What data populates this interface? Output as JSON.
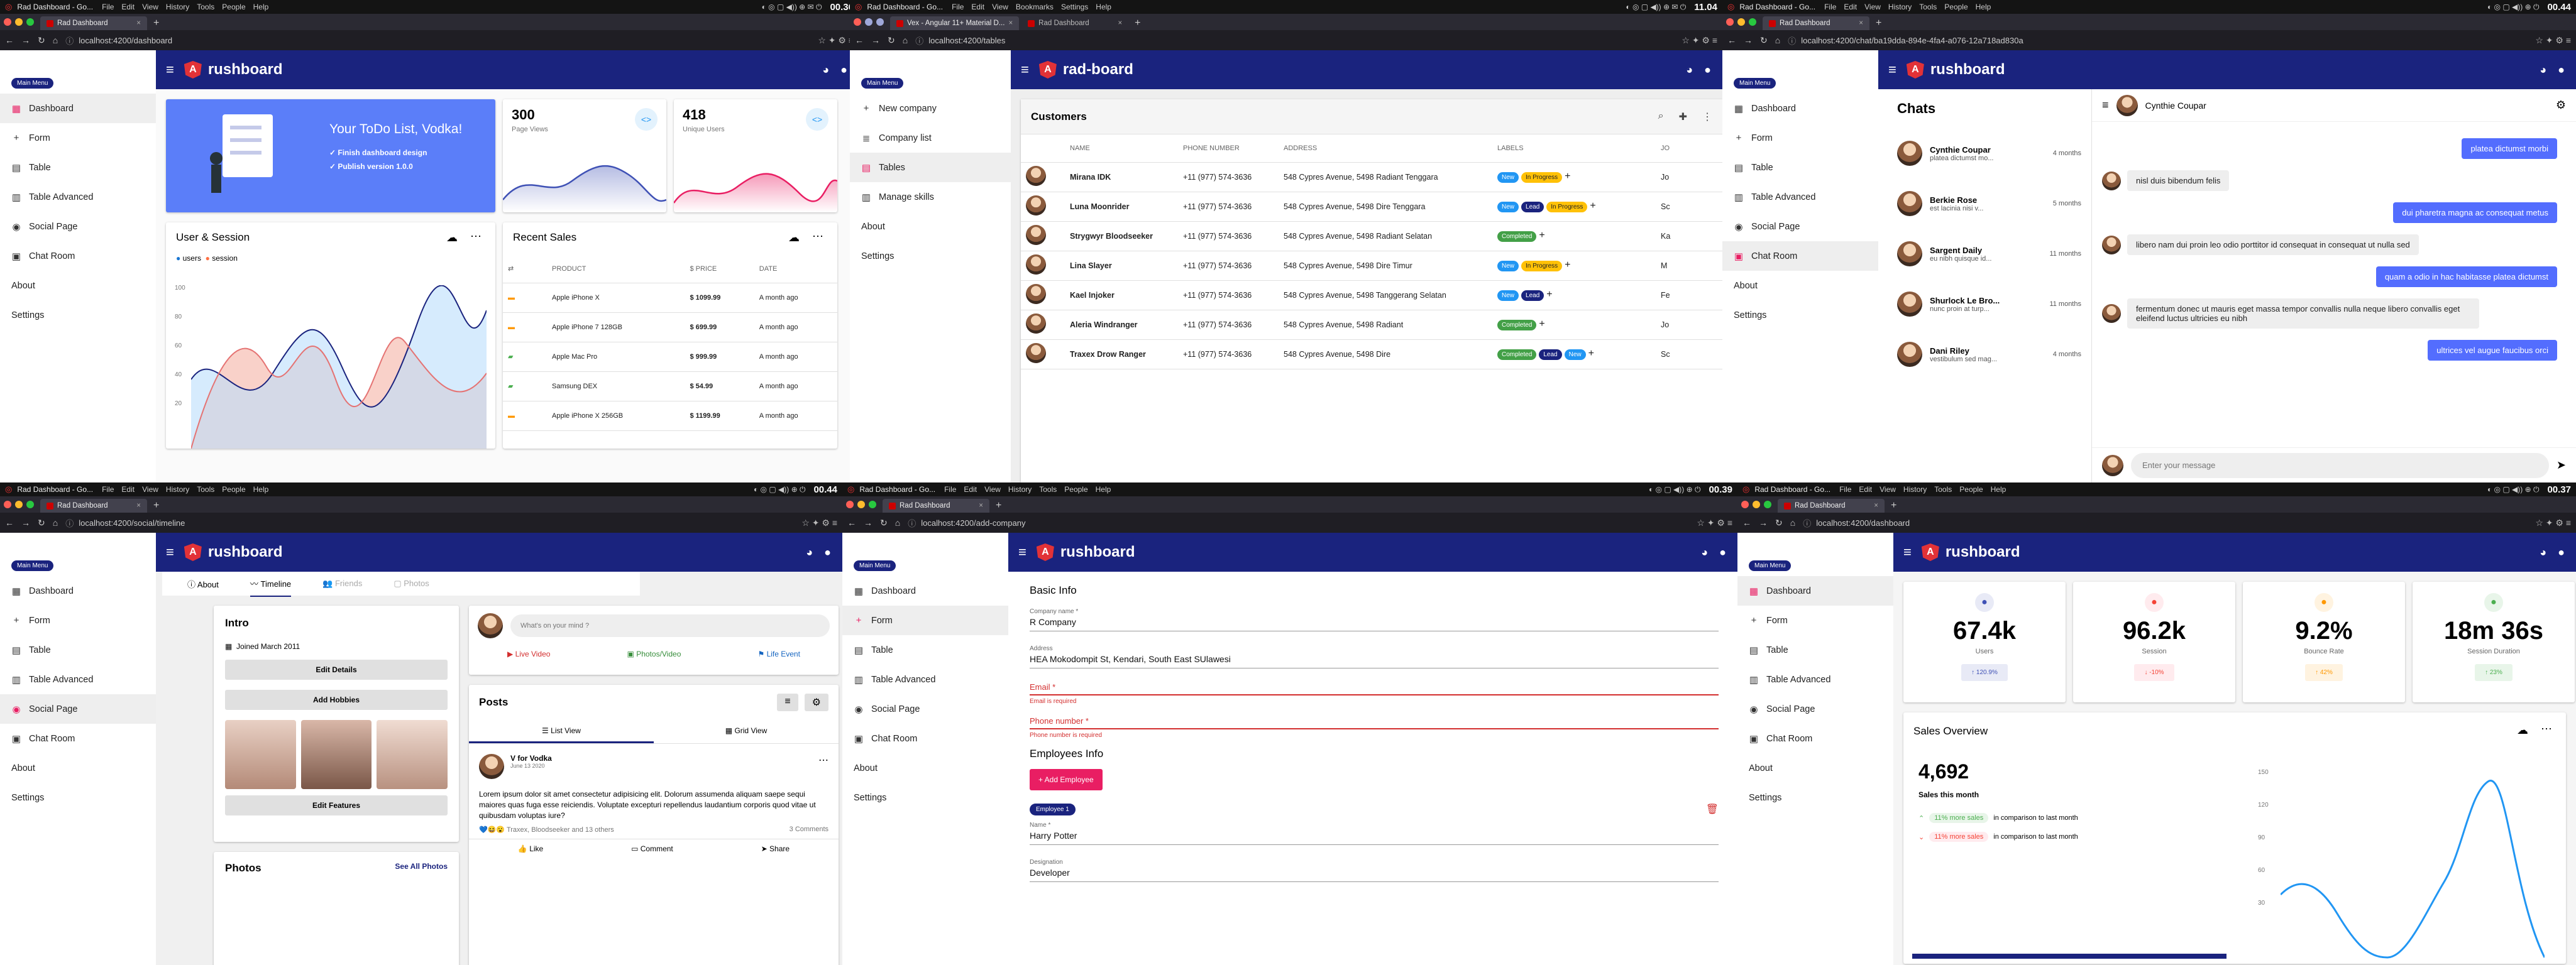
{
  "panels": [
    {
      "clock": "00.36",
      "apptitle": "Rad Dashboard - Go...",
      "menus": [
        "File",
        "Edit",
        "View",
        "History",
        "Tools",
        "People",
        "Help"
      ],
      "tabs": [
        "Rad Dashboard"
      ],
      "url": "localhost:4200/dashboard"
    },
    {
      "clock": "11.04",
      "apptitle": "Rad Dashboard - Go...",
      "menus": [
        "File",
        "Edit",
        "View",
        "Bookmarks",
        "Settings",
        "Help"
      ],
      "tabs": [
        "Vex - Angular 11+ Material D...",
        "Rad Dashboard"
      ],
      "url": "localhost:4200/tables"
    },
    {
      "clock": "00.44",
      "apptitle": "Rad Dashboard - Go...",
      "menus": [
        "File",
        "Edit",
        "View",
        "History",
        "Tools",
        "People",
        "Help"
      ],
      "tabs": [
        "Rad Dashboard"
      ],
      "url": "localhost:4200/chat/ba19dda-894e-4fa4-a076-12a718ad830a"
    },
    {
      "clock": "00.44",
      "apptitle": "Rad Dashboard - Go...",
      "menus": [
        "File",
        "Edit",
        "View",
        "History",
        "Tools",
        "People",
        "Help"
      ],
      "tabs": [
        "Rad Dashboard"
      ],
      "url": "localhost:4200/social/timeline"
    },
    {
      "clock": "00.39",
      "apptitle": "Rad Dashboard - Go...",
      "menus": [
        "File",
        "Edit",
        "View",
        "History",
        "Tools",
        "People",
        "Help"
      ],
      "tabs": [
        "Rad Dashboard"
      ],
      "url": "localhost:4200/add-company"
    },
    {
      "clock": "00.37",
      "apptitle": "Rad Dashboard - Go...",
      "menus": [
        "File",
        "Edit",
        "View",
        "History",
        "Tools",
        "People",
        "Help"
      ],
      "tabs": [
        "Rad Dashboard"
      ],
      "url": "localhost:4200/dashboard"
    }
  ],
  "brand": "rushboard",
  "brand_alt": "rad-board",
  "main_menu": "Main Menu",
  "sidebar_items": [
    "Dashboard",
    "Form",
    "Table",
    "Table Advanced",
    "Social Page",
    "Chat Room",
    "About",
    "Settings"
  ],
  "sidebar_tables": [
    "New company",
    "Company list",
    "Tables",
    "Manage skills",
    "About",
    "Settings"
  ],
  "dash1": {
    "todo_title": "Your ToDo List, Vodka!",
    "todo_items": [
      "Finish dashboard design",
      "Publish version 1.0.0"
    ],
    "page_views": "300",
    "page_views_label": "Page Views",
    "unique_users": "418",
    "unique_users_label": "Unique Users",
    "user_session_title": "User & Session",
    "legend": [
      "users",
      "session"
    ],
    "y_ticks": [
      "100",
      "80",
      "60",
      "40",
      "20"
    ],
    "recent_sales_title": "Recent Sales",
    "sales_headers": [
      "PRODUCT",
      "$ PRICE",
      "DATE"
    ],
    "sales_rows": [
      [
        "Apple iPhone X",
        "$ 1099.99",
        "A month ago"
      ],
      [
        "Apple iPhone 7 128GB",
        "$ 699.99",
        "A month ago"
      ],
      [
        "Apple Mac Pro",
        "$ 999.99",
        "A month ago"
      ],
      [
        "Samsung DEX",
        "$ 54.99",
        "A month ago"
      ],
      [
        "Apple iPhone X 256GB",
        "$ 1199.99",
        "A month ago"
      ]
    ]
  },
  "tables": {
    "title": "Customers",
    "headers": [
      "NAME",
      "PHONE NUMBER",
      "ADDRESS",
      "LABELS",
      "JO"
    ],
    "rows": [
      {
        "name": "Mirana IDK",
        "phone": "+11 (977) 574-3636",
        "address": "548 Cypres Avenue, 5498 Radiant Tenggara",
        "labels": [
          "New",
          "In Progress"
        ]
      },
      {
        "name": "Luna Moonrider",
        "phone": "+11 (977) 574-3636",
        "address": "548 Cypres Avenue, 5498 Dire Tenggara",
        "labels": [
          "New",
          "Lead",
          "In Progress"
        ]
      },
      {
        "name": "Strygwyr Bloodseeker",
        "phone": "+11 (977) 574-3636",
        "address": "548 Cypres Avenue, 5498 Radiant Selatan",
        "labels": [
          "Completed"
        ]
      },
      {
        "name": "Lina Slayer",
        "phone": "+11 (977) 574-3636",
        "address": "548 Cypres Avenue, 5498 Dire Timur",
        "labels": [
          "New",
          "In Progress"
        ]
      },
      {
        "name": "Kael Injoker",
        "phone": "+11 (977) 574-3636",
        "address": "548 Cypres Avenue, 5498 Tanggerang Selatan",
        "labels": [
          "New",
          "Lead"
        ]
      },
      {
        "name": "Aleria Windranger",
        "phone": "+11 (977) 574-3636",
        "address": "548 Cypres Avenue, 5498 Radiant",
        "labels": [
          "Completed"
        ]
      },
      {
        "name": "Traxex Drow Ranger",
        "phone": "+11 (977) 574-3636",
        "address": "548 Cypres Avenue, 5498 Dire",
        "labels": [
          "Completed",
          "Lead",
          "New"
        ]
      }
    ],
    "jo_col": [
      "Jo",
      "Sc",
      "Ka",
      "M",
      "Fe",
      "Jo",
      "Sc"
    ]
  },
  "chat": {
    "title": "Chats",
    "header_name": "Cynthie Coupar",
    "list": [
      {
        "name": "Cynthie Coupar",
        "preview": "platea dictumst mo...",
        "time": "4 months"
      },
      {
        "name": "Berkie Rose",
        "preview": "est lacinia nisi v...",
        "time": "5 months"
      },
      {
        "name": "Sargent Daily",
        "preview": "eu nibh quisque id...",
        "time": "11 months"
      },
      {
        "name": "Shurlock Le Bro...",
        "preview": "nunc proin at turp...",
        "time": "11 months"
      },
      {
        "name": "Dani Riley",
        "preview": "vestibulum sed mag...",
        "time": "4 months"
      }
    ],
    "messages": [
      {
        "me": true,
        "text": "platea dictumst morbi"
      },
      {
        "me": false,
        "text": "nisl duis bibendum felis"
      },
      {
        "me": true,
        "text": "dui pharetra magna ac consequat metus"
      },
      {
        "me": false,
        "text": "libero nam dui proin leo odio porttitor id consequat in consequat ut nulla sed"
      },
      {
        "me": true,
        "text": "quam a odio in hac habitasse platea dictumst"
      },
      {
        "me": false,
        "text": "fermentum donec ut mauris eget massa tempor convallis nulla neque libero convallis eget eleifend luctus ultricies eu nibh"
      },
      {
        "me": true,
        "text": "ultrices vel augue faucibus orci"
      }
    ],
    "input_placeholder": "Enter your message"
  },
  "social": {
    "tabs": [
      "About",
      "Timeline",
      "Friends",
      "Photos"
    ],
    "intro_title": "Intro",
    "joined": "Joined March 2011",
    "edit_details": "Edit Details",
    "add_hobbies": "Add Hobbies",
    "edit_features": "Edit Features",
    "photos_title": "Photos",
    "see_all": "See All Photos",
    "mind_placeholder": "What's on your mind ?",
    "post_actions": [
      "Live Video",
      "Photos/Video",
      "Life Event"
    ],
    "posts_title": "Posts",
    "view_tabs": [
      "List View",
      "Grid View"
    ],
    "post_author": "V for Vodka",
    "post_date": "June 13 2020",
    "post_text": "Lorem ipsum dolor sit amet consectetur adipisicing elit. Dolorum assumenda aliquam saepe sequi maiores quas fuga esse reiciendis. Voluptate excepturi repellendus laudantium corporis quod vitae ut quibusdam voluptas iure?",
    "reactions": "Traxex, Bloodseeker and 13 others",
    "comments": "3 Comments",
    "post_buttons": [
      "Like",
      "Comment",
      "Share"
    ]
  },
  "form": {
    "basic_info": "Basic Info",
    "company_label": "Company name *",
    "company_value": "R Company",
    "address_label": "Address",
    "address_value": "HEA Mokodompit St, Kendari, South East SUlawesi",
    "email_label": "Email *",
    "email_error": "Email is required",
    "phone_label": "Phone number *",
    "phone_error": "Phone number is required",
    "employees_info": "Employees Info",
    "add_employee": "+ Add Employee",
    "employee_chip": "Employee 1",
    "name_label": "Name *",
    "name_value": "Harry Potter",
    "designation_label": "Designation",
    "designation_value": "Developer"
  },
  "dash2": {
    "stats": [
      {
        "value": "67.4k",
        "label": "Users",
        "delta": "↑ 120.9%",
        "color": "#3f51b5",
        "bg": "#e8eaf6"
      },
      {
        "value": "96.2k",
        "label": "Session",
        "delta": "↓ -10%",
        "color": "#f44336",
        "bg": "#ffebee"
      },
      {
        "value": "9.2%",
        "label": "Bounce Rate",
        "delta": "↑ 42%",
        "color": "#ff9800",
        "bg": "#fff3e0"
      },
      {
        "value": "18m 36s",
        "label": "Session Duration",
        "delta": "↑ 23%",
        "color": "#4caf50",
        "bg": "#e8f5e9"
      }
    ],
    "sales_overview": "Sales Overview",
    "sales_total": "4,692",
    "sales_month": "Sales this month",
    "compare": [
      {
        "badge": "11% more sales",
        "text": "in comparison to last month",
        "color": "#4caf50",
        "bg": "#e8f5e9"
      },
      {
        "badge": "11% more sales",
        "text": "in comparison to last month",
        "color": "#f44336",
        "bg": "#ffebee"
      }
    ],
    "y_ticks": [
      "150",
      "120",
      "90",
      "60",
      "30"
    ]
  },
  "user_session_chart": {
    "type": "area",
    "series": [
      {
        "name": "users"
      },
      {
        "name": "session"
      }
    ],
    "y_ticks": [
      100,
      80,
      60,
      40,
      20
    ],
    "ylim": [
      0,
      100
    ]
  }
}
